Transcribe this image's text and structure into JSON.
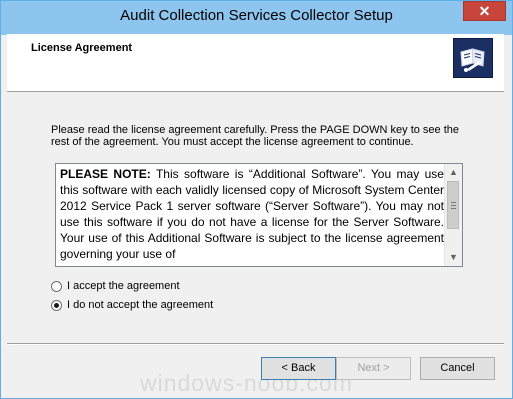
{
  "window": {
    "title": "Audit Collection Services Collector Setup",
    "close_label": "✕"
  },
  "header": {
    "title": "License Agreement",
    "icon": "license-book-icon"
  },
  "main": {
    "instructions": "Please read the license agreement carefully. Press the PAGE DOWN key to see the rest of the agreement. You must accept the license agreement to continue.",
    "license": {
      "bold_lead": "PLEASE NOTE:",
      "text": " This software is “Additional Software”. You may use this software with each validly licensed copy of Microsoft System Center 2012 Service Pack 1 server software (“Server Software”). You may not use this software if you do not have a license for the Server Software. Your use of this Additional Software is subject to the license agreement governing your use of"
    },
    "options": [
      {
        "label": "I accept the agreement",
        "selected": false
      },
      {
        "label": "I do not accept the agreement",
        "selected": true
      }
    ]
  },
  "buttons": {
    "back": "< Back",
    "next": "Next >",
    "cancel": "Cancel"
  },
  "watermark": "windows-noob.com"
}
